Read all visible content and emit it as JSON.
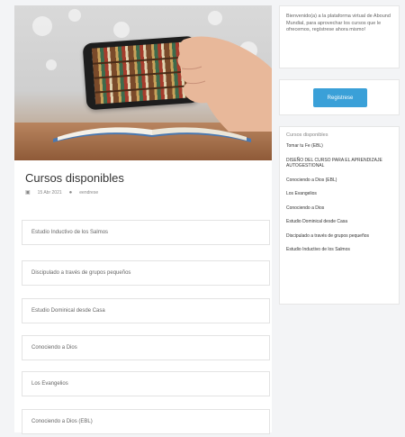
{
  "main": {
    "title": "Cursos disponibles",
    "meta": {
      "date": "15 Abr 2021",
      "author": "eendrese"
    },
    "courses": [
      "Estudio Inductivo de los Salmos",
      "Discipulado a través de grupos pequeños",
      "Estudio Dominical desde Casa",
      "Conociendo a Dios",
      "Los Evangelios",
      "Conociendo a Dios (EBL)"
    ]
  },
  "sidebar": {
    "welcome_text": "Bienvenido(a) a la plataforma virtual de Abound Mundial, para aprovechar los cursos que le ofrecemos, regístrese ahora mismo!",
    "register_label": "Registrese",
    "courses_title": "Cursos disponibles",
    "course_links": [
      "Tomar tu Fe (EBL)",
      "DISEÑO DEL CURSO PARA EL APRENDIZAJE AUTOGESTIONAL",
      "Conociendo a Dios (EBL)",
      "Los Evangelios",
      "Conociendo a Dios",
      "Estudio Dominical desde Casa",
      "Discipulado a través de grupos pequeños",
      "Estudio Inductivo de los Salmos"
    ]
  },
  "colors": {
    "accent": "#3aa0d8",
    "background": "#f3f4f6"
  }
}
